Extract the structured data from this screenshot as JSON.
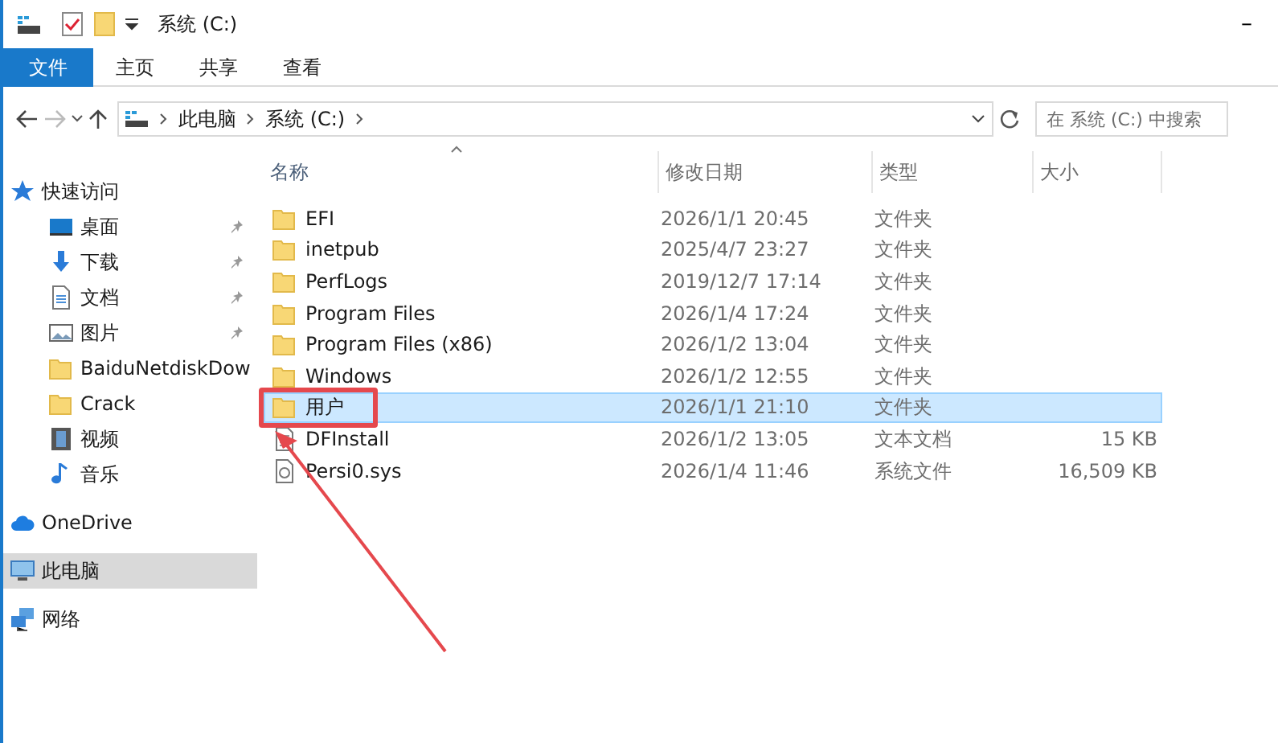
{
  "window": {
    "title": "系统 (C:)",
    "minimize": "–"
  },
  "ribbon_tabs": [
    {
      "label": "文件",
      "kind": "file"
    },
    {
      "label": "主页",
      "kind": "tab"
    },
    {
      "label": "共享",
      "kind": "tab"
    },
    {
      "label": "查看",
      "kind": "tab"
    }
  ],
  "navigation": {
    "forward_disabled": true
  },
  "address": {
    "crumbs": [
      "此电脑",
      "系统 (C:)"
    ]
  },
  "search": {
    "placeholder": "在 系统 (C:) 中搜索"
  },
  "sidebar": {
    "items": [
      {
        "label": "快速访问",
        "kind": "star",
        "selected": false,
        "children": [
          {
            "label": "桌面",
            "kind": "desktop",
            "pinned": true,
            "selected": false
          },
          {
            "label": "下载",
            "kind": "download",
            "pinned": true,
            "selected": false
          },
          {
            "label": "文档",
            "kind": "document",
            "pinned": true,
            "selected": false
          },
          {
            "label": "图片",
            "kind": "picture",
            "pinned": true,
            "selected": false
          },
          {
            "label": "BaiduNetdiskDow",
            "kind": "folder",
            "pinned": false,
            "selected": false
          },
          {
            "label": "Crack",
            "kind": "folder",
            "pinned": false,
            "selected": false
          },
          {
            "label": "视频",
            "kind": "video",
            "pinned": false,
            "selected": false
          },
          {
            "label": "音乐",
            "kind": "music",
            "pinned": false,
            "selected": false
          }
        ]
      },
      {
        "label": "OneDrive",
        "kind": "cloud",
        "selected": false
      },
      {
        "label": "此电脑",
        "kind": "computer",
        "selected": true
      },
      {
        "label": "网络",
        "kind": "network",
        "selected": false
      }
    ]
  },
  "table": {
    "columns": [
      "名称",
      "修改日期",
      "类型",
      "大小"
    ],
    "rows": [
      {
        "name": "EFI",
        "date": "2026/1/1 20:45",
        "type": "文件夹",
        "kind": "folder",
        "selected": false,
        "callout": false
      },
      {
        "name": "inetpub",
        "date": "2025/4/7 23:27",
        "type": "文件夹",
        "kind": "folder",
        "selected": false,
        "callout": false
      },
      {
        "name": "PerfLogs",
        "date": "2019/12/7 17:14",
        "type": "文件夹",
        "kind": "folder",
        "selected": false,
        "callout": false
      },
      {
        "name": "Program Files",
        "date": "2026/1/4 17:24",
        "type": "文件夹",
        "kind": "folder",
        "selected": false,
        "callout": false
      },
      {
        "name": "Program Files (x86)",
        "date": "2026/1/2 13:04",
        "type": "文件夹",
        "kind": "folder",
        "selected": false,
        "callout": false
      },
      {
        "name": "Windows",
        "date": "2026/1/2 12:55",
        "type": "文件夹",
        "kind": "folder",
        "selected": false,
        "callout": false
      },
      {
        "name": "用户",
        "date": "2026/1/1 21:10",
        "type": "文件夹",
        "kind": "folder",
        "selected": true,
        "callout": true
      },
      {
        "name": "DFInstall",
        "date": "2026/1/2 13:05",
        "type": "文本文档",
        "size": "15 KB",
        "kind": "text",
        "selected": false,
        "callout": false
      },
      {
        "name": "Persi0.sys",
        "date": "2026/1/4 11:46",
        "type": "系统文件",
        "size": "16,509 KB",
        "kind": "system",
        "selected": false,
        "callout": false
      }
    ]
  }
}
